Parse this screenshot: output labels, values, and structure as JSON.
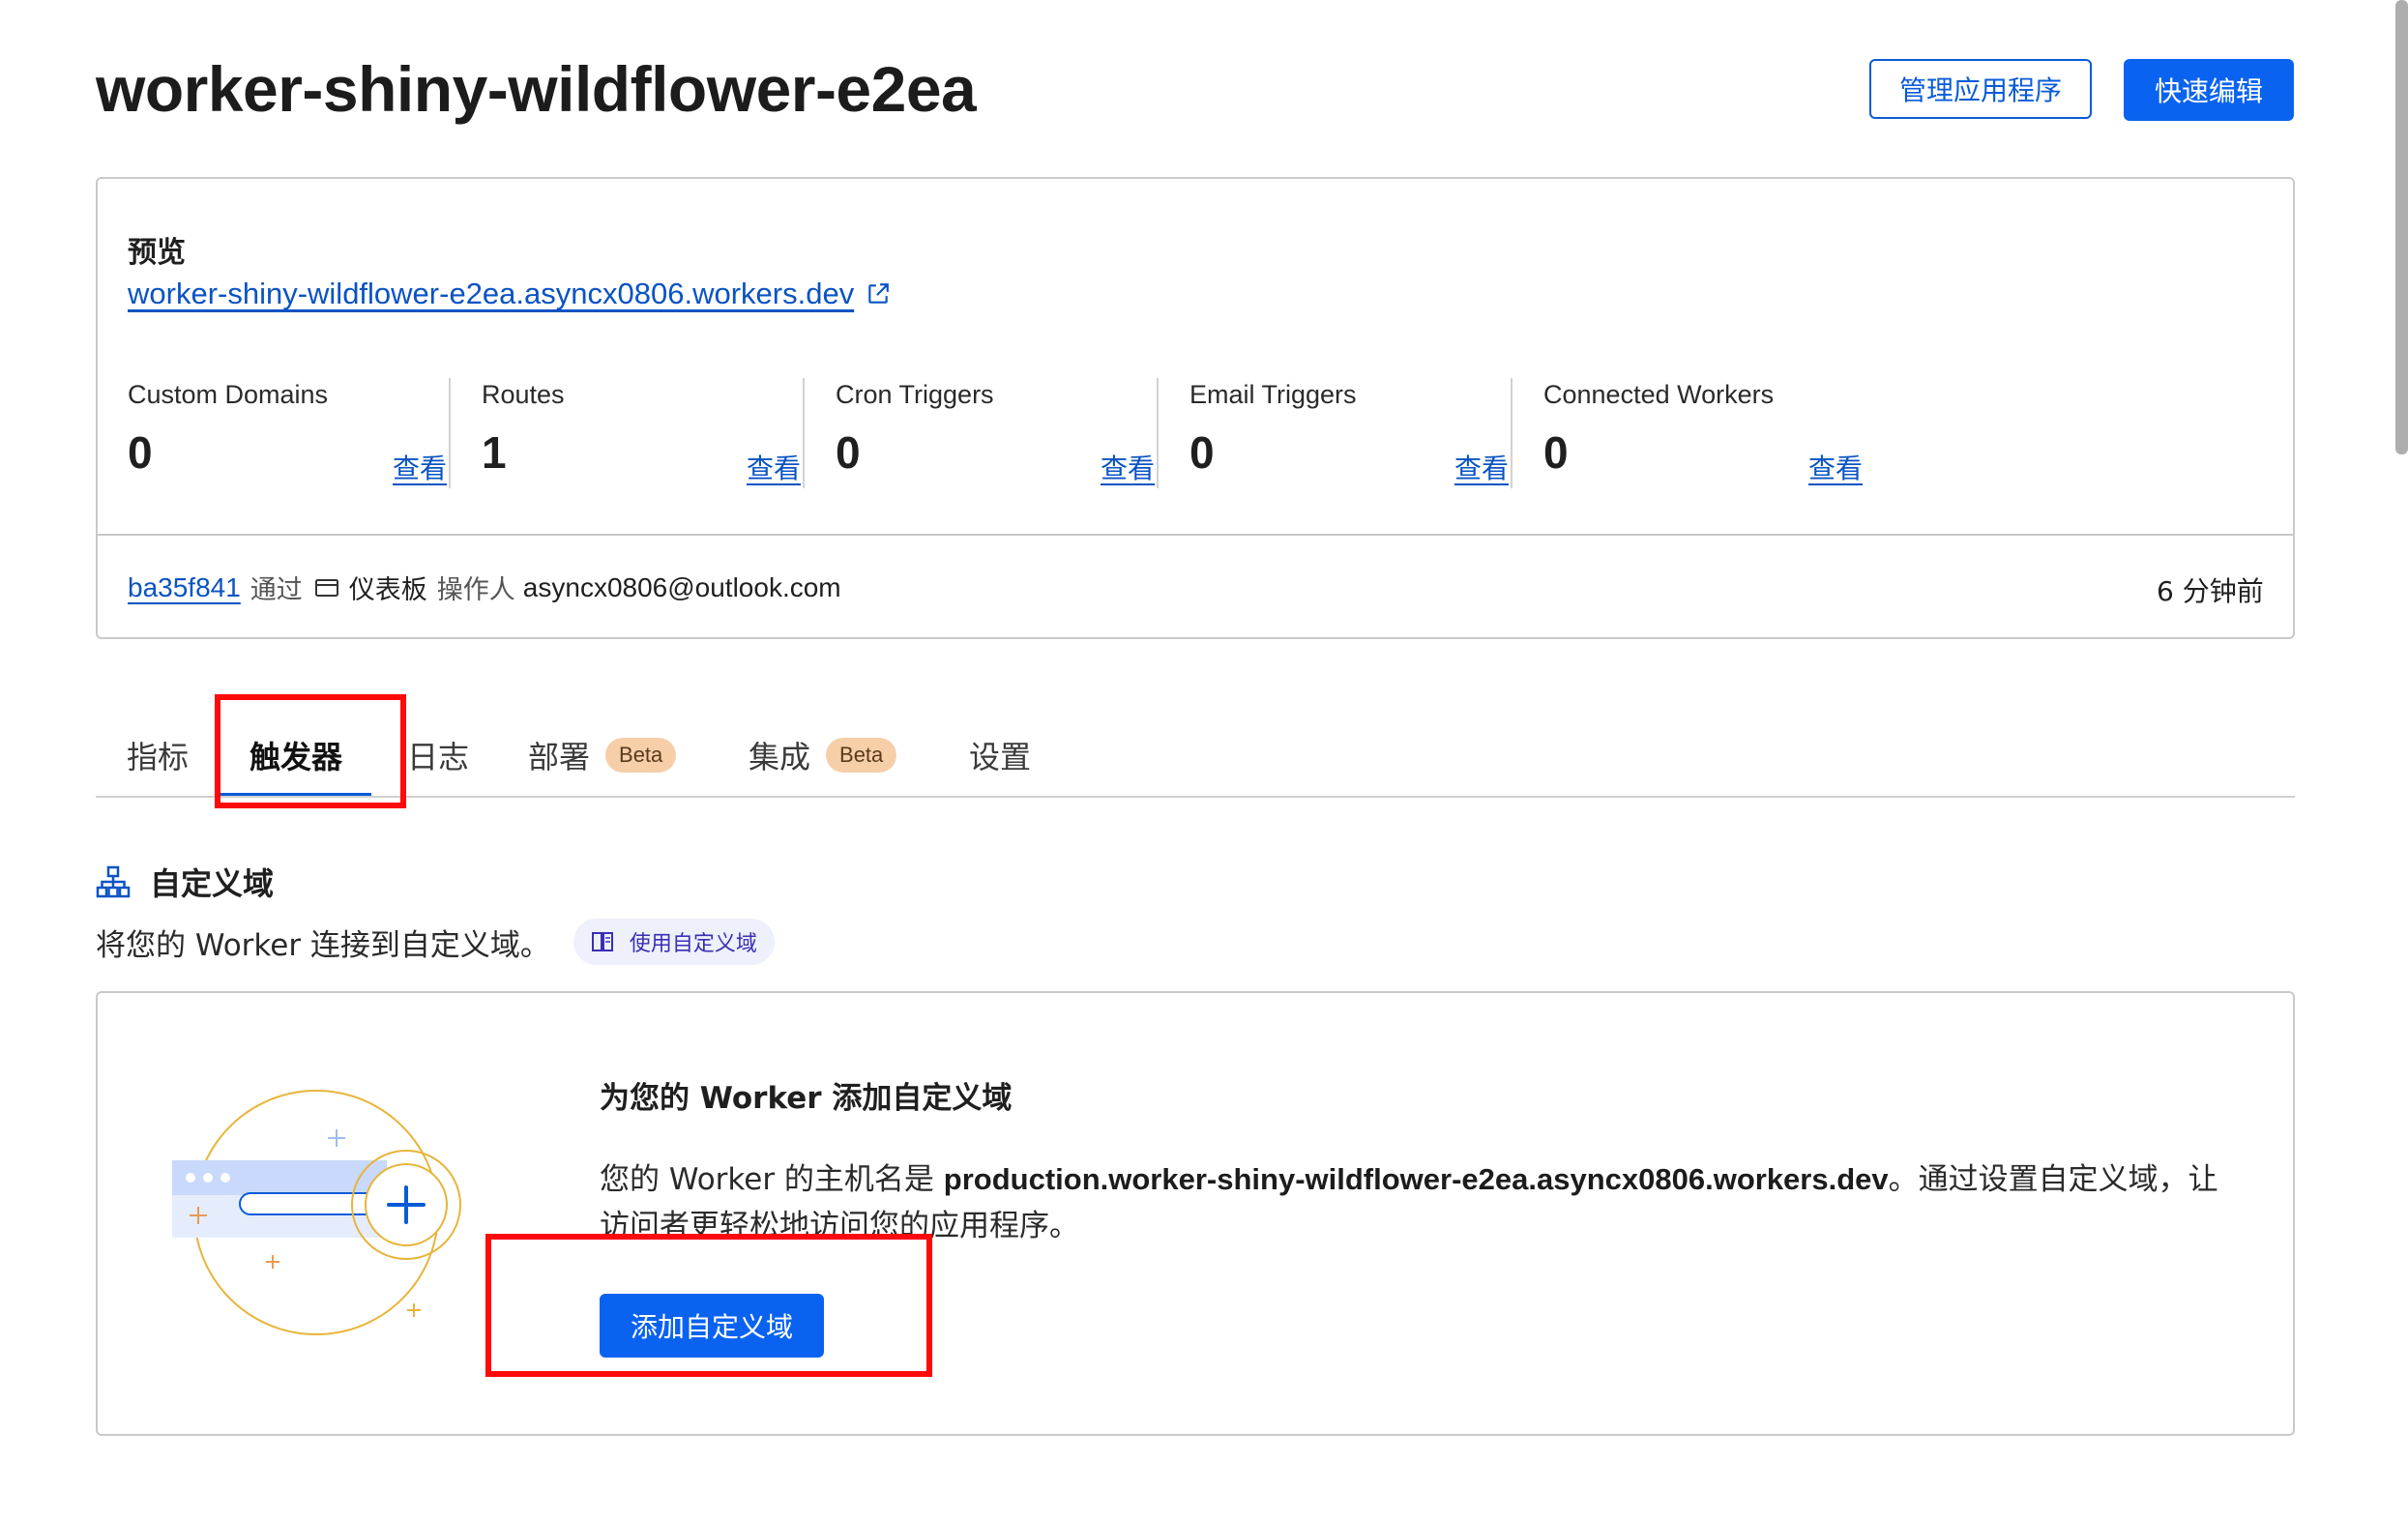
{
  "header": {
    "title": "worker-shiny-wildflower-e2ea",
    "manage_button": "管理应用程序",
    "quick_edit_button": "快速编辑"
  },
  "overview": {
    "preview_label": "预览",
    "preview_url": "worker-shiny-wildflower-e2ea.asyncx0806.workers.dev",
    "stats": [
      {
        "label": "Custom Domains",
        "value": "0",
        "link": "查看"
      },
      {
        "label": "Routes",
        "value": "1",
        "link": "查看"
      },
      {
        "label": "Cron Triggers",
        "value": "0",
        "link": "查看"
      },
      {
        "label": "Email Triggers",
        "value": "0",
        "link": "查看"
      },
      {
        "label": "Connected Workers",
        "value": "0",
        "link": "查看"
      }
    ],
    "deployment": {
      "commit": "ba35f841",
      "via": "通过",
      "source": "仪表板",
      "operator_label": "操作人",
      "operator": "asyncx0806@outlook.com",
      "time_ago": "6 分钟前"
    }
  },
  "tabs": [
    {
      "label": "指标"
    },
    {
      "label": "触发器",
      "active": true
    },
    {
      "label": "日志"
    },
    {
      "label": "部署",
      "badge": "Beta"
    },
    {
      "label": "集成",
      "badge": "Beta"
    },
    {
      "label": "设置"
    }
  ],
  "custom_domains": {
    "title": "自定义域",
    "description": "将您的 Worker 连接到自定义域。",
    "doc_link": "使用自定义域",
    "cta_title": "为您的 Worker 添加自定义域",
    "cta_body_prefix": "您的 Worker 的主机名是 ",
    "cta_hostname": "production.worker-shiny-wildflower-e2ea.asyncx0806.workers.dev",
    "cta_body_suffix": "。通过设置自定义域，让访问者更轻松地访问您的应用程序。",
    "add_button": "添加自定义域"
  },
  "colors": {
    "accent": "#0a63f0",
    "link": "#0a53c4",
    "annotation_red": "#ff0a0a",
    "badge_bg": "#f6cfa9"
  }
}
